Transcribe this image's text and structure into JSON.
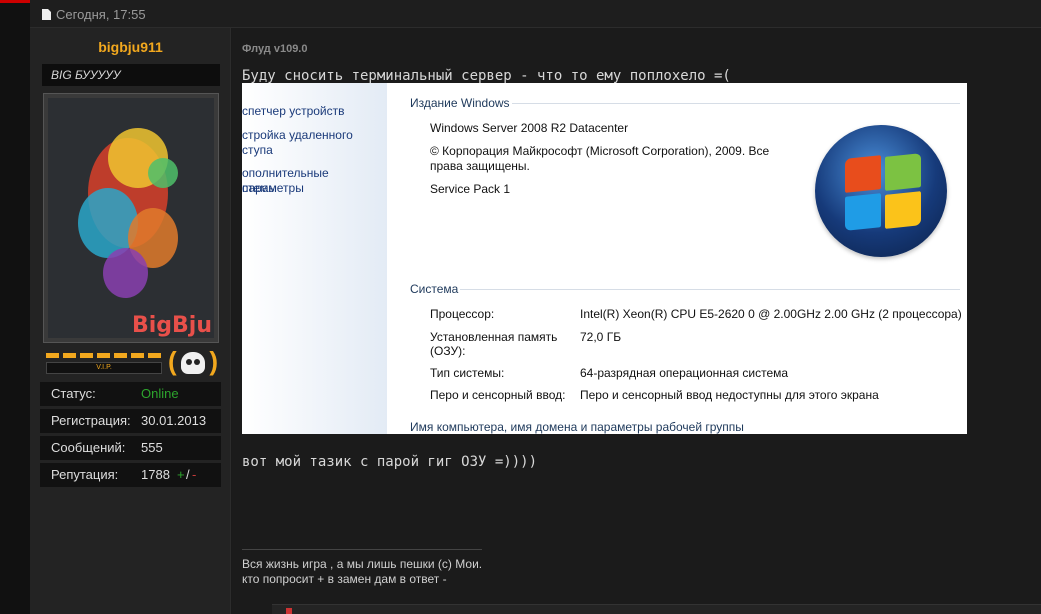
{
  "post": {
    "date": "Сегодня, 17:55"
  },
  "author": {
    "name": "bigbju911",
    "title": "BIG БУУУУУ",
    "avatar_logo": "BigBju",
    "vip_label": "V.I.P."
  },
  "stats": [
    {
      "key": "Статус:",
      "value": "Online"
    },
    {
      "key": "Регистрация:",
      "value": "30.01.2013"
    },
    {
      "key": "Сообщений:",
      "value": "555"
    },
    {
      "key": "Репутация:",
      "value": "1788"
    }
  ],
  "reputation": {
    "plus": "+",
    "sep": "/",
    "minus": "-"
  },
  "thread": {
    "title": "Флуд v109.0"
  },
  "message": {
    "line1": "Буду сносить терминальный сервер - что то ему поплохело =(",
    "line2": "вот мой тазик с парой гиг ОЗУ =))))"
  },
  "screenshot": {
    "nav": [
      "спетчер устройств",
      "стройка удаленного",
      "ступа",
      "ополнительные параметры",
      "стемы"
    ],
    "edition_header": "Издание Windows",
    "edition_name": "Windows Server 2008 R2 Datacenter",
    "copyright_1": "© Корпорация Майкрософт (Microsoft Corporation), 2009. Все",
    "copyright_2": "права защищены.",
    "service_pack": "Service Pack 1",
    "system_header": "Система",
    "rows": [
      {
        "label": "Процессор:",
        "value": "Intel(R) Xeon(R) CPU E5-2620 0 @ 2.00GHz   2.00 GHz  (2 процессора)"
      },
      {
        "label": "Установленная память",
        "value": "72,0 ГБ"
      },
      {
        "label": "(ОЗУ):",
        "value": ""
      },
      {
        "label": "Тип системы:",
        "value": "64-разрядная операционная система"
      },
      {
        "label": "Перо и сенсорный ввод:",
        "value": "Перо и сенсорный ввод недоступны для этого экрана"
      }
    ],
    "computer_header": "Имя компьютера, имя домена и параметры рабочей группы"
  },
  "signature": {
    "line1": "Вся жизнь игра , а мы лишь пешки (c) Мои.",
    "line2": "кто попросит + в замен дам в ответ -"
  },
  "colors": {
    "accent": "#f2a81e",
    "online": "#2da52d",
    "negative": "#c43a3a",
    "link": "#1a3a7a"
  }
}
